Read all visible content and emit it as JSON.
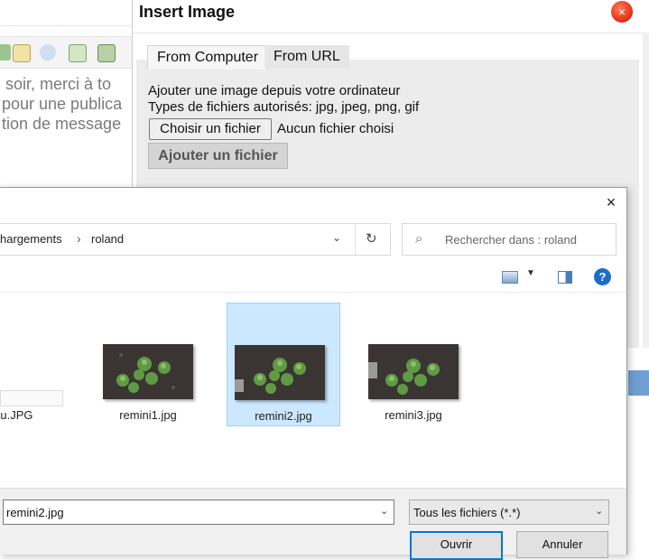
{
  "editor": {
    "lines": [
      "soir, merci à to",
      "pour une publica",
      "tion de message"
    ]
  },
  "insert_dialog": {
    "title": "Insert Image",
    "close_glyph": "×",
    "tabs": [
      "From Computer",
      "From URL"
    ],
    "description": "Ajouter une image depuis votre ordinateur",
    "allowed_types": "Types de fichiers autorisés: jpg, jpeg, png, gif",
    "choose_file_label": "Choisir un fichier",
    "no_file_label": "Aucun fichier choisi",
    "upload_label": "Ajouter un fichier"
  },
  "file_dialog": {
    "close_glyph": "×",
    "breadcrumb": [
      "hargements",
      "roland"
    ],
    "breadcrumb_separator": "›",
    "dropdown_glyph": "⌄",
    "refresh_glyph": "↻",
    "search_icon": "⌕",
    "search_placeholder": "Rechercher dans : roland",
    "help_glyph": "?",
    "files": [
      {
        "name": "ndeau.JPG",
        "selected": false,
        "partial": true
      },
      {
        "name": "remini1.jpg",
        "selected": false
      },
      {
        "name": "remini2.jpg",
        "selected": true
      },
      {
        "name": "remini3.jpg",
        "selected": false
      }
    ],
    "filename_value": "remini2.jpg",
    "filetype_value": "Tous les fichiers (*.*)",
    "open_label": "Ouvrir",
    "cancel_label": "Annuler"
  },
  "colors": {
    "selection": "#cce8ff",
    "primary_button_border": "#0078d7",
    "close_button": "#e02d10"
  }
}
